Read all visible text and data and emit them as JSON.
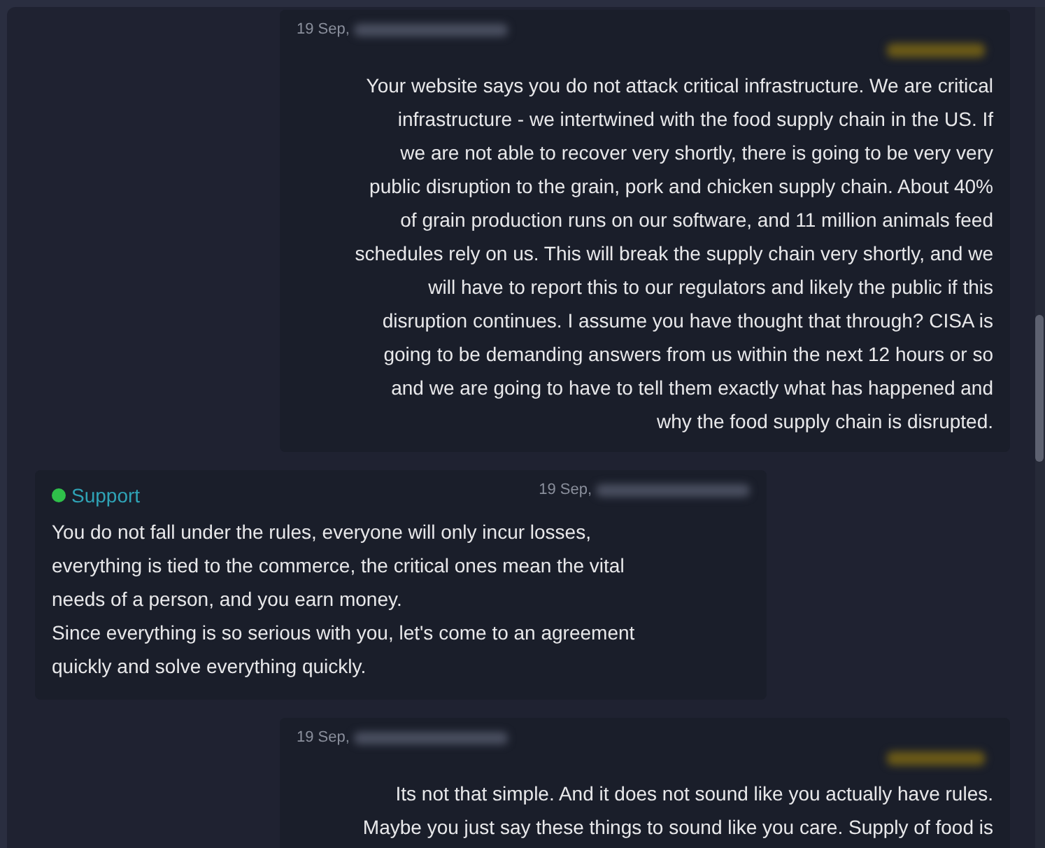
{
  "messages": [
    {
      "kind": "outgoing",
      "date": "19 Sep,",
      "text": "Your website says you do not attack critical infrastructure. We are critical\ninfrastructure - we intertwined with the food supply chain in the US. If\nwe are not able to recover very shortly, there is going to be very very\npublic disruption to the grain, pork and chicken supply chain. About 40%\nof grain production runs on our software, and 11 million animals feed\nschedules rely on us. This will break the supply chain very shortly, and we\nwill have to report this to our regulators and likely the public if this\ndisruption continues. I assume you have thought that through? CISA is\ngoing to be demanding answers from us within the next 12 hours or so\nand we are going to have to tell them exactly what has happened and\nwhy the food supply chain is disrupted."
    },
    {
      "kind": "incoming",
      "sender": "Support",
      "online": true,
      "date": "19 Sep,",
      "text": "You do not fall under the rules, everyone will only incur losses,\neverything is tied to the commerce, the critical ones mean the vital\nneeds of a person, and you earn money.\nSince everything is so serious with you, let's come to an agreement\nquickly and solve everything quickly."
    },
    {
      "kind": "outgoing",
      "date": "19 Sep,",
      "text": "Its not that simple. And it does not sound like you actually have rules.\nMaybe you just say these things to sound like you care. Supply of food is"
    }
  ]
}
